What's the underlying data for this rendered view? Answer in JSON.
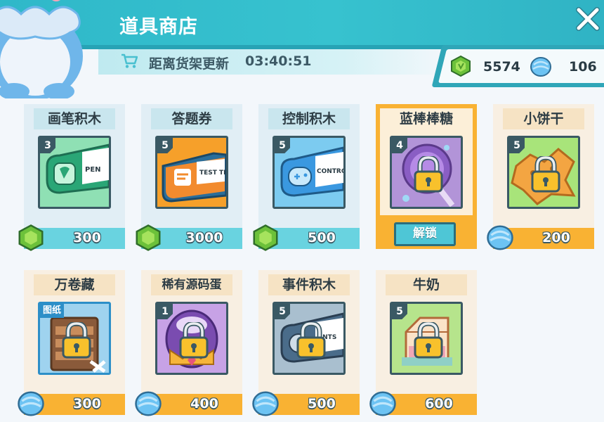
{
  "header": {
    "title": "道具商店",
    "refresh_label": "距离货架更新",
    "refresh_time": "03:40:51"
  },
  "currency": {
    "gem_value": "5574",
    "candy_value": "106"
  },
  "colors": {
    "header": "#2fb8c9",
    "price_cyan": "#69d3e0",
    "price_orange": "#f9b233",
    "frame": "#3a5964"
  },
  "items": [
    {
      "name": "画笔积木",
      "level": "3",
      "price": "300",
      "currency": "gem-icon",
      "locked": false,
      "art_text": "PEN"
    },
    {
      "name": "答题券",
      "level": "5",
      "price": "3000",
      "currency": "gem-icon",
      "locked": false,
      "art_text": "TEST TI"
    },
    {
      "name": "控制积木",
      "level": "5",
      "price": "500",
      "currency": "gem-icon",
      "locked": false,
      "art_text": "CONTRO"
    },
    {
      "name": "蓝棒棒糖",
      "level": "4",
      "price": "",
      "currency": "",
      "locked": true,
      "selected": true,
      "unlock_label": "解锁"
    },
    {
      "name": "小饼干",
      "level": "5",
      "price": "200",
      "currency": "candy-icon",
      "locked": true
    },
    {
      "name": "万卷藏",
      "level": "",
      "price": "300",
      "currency": "candy-icon",
      "locked": true,
      "tag": "图纸"
    },
    {
      "name": "稀有源码蛋",
      "level": "1",
      "price": "400",
      "currency": "candy-icon",
      "locked": true
    },
    {
      "name": "事件积木",
      "level": "5",
      "price": "500",
      "currency": "candy-icon",
      "locked": true,
      "art_text": "ENTS"
    },
    {
      "name": "牛奶",
      "level": "5",
      "price": "600",
      "currency": "candy-icon",
      "locked": true
    }
  ]
}
